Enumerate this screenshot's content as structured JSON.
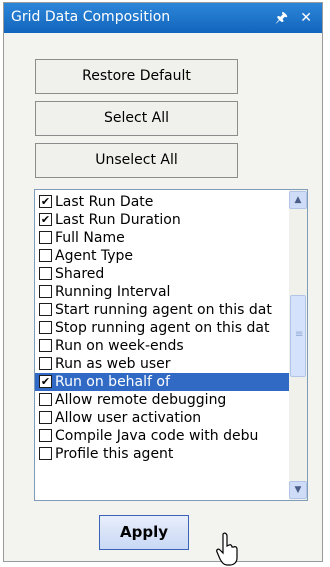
{
  "window": {
    "title": "Grid Data Composition",
    "pin_icon": "pin-icon",
    "close_icon": "close-icon"
  },
  "buttons": {
    "restore_default": "Restore Default",
    "select_all": "Select All",
    "unselect_all": "Unselect All",
    "apply": "Apply"
  },
  "list": {
    "items": [
      {
        "label": "Last Run Date",
        "checked": true,
        "selected": false
      },
      {
        "label": "Last Run Duration",
        "checked": true,
        "selected": false
      },
      {
        "label": "Full Name",
        "checked": false,
        "selected": false
      },
      {
        "label": "Agent Type",
        "checked": false,
        "selected": false
      },
      {
        "label": "Shared",
        "checked": false,
        "selected": false
      },
      {
        "label": "Running Interval",
        "checked": false,
        "selected": false
      },
      {
        "label": "Start running agent on this dat",
        "checked": false,
        "selected": false
      },
      {
        "label": "Stop running agent on this dat",
        "checked": false,
        "selected": false
      },
      {
        "label": "Run on week-ends",
        "checked": false,
        "selected": false
      },
      {
        "label": "Run as web user",
        "checked": false,
        "selected": false
      },
      {
        "label": "Run on behalf of",
        "checked": true,
        "selected": true
      },
      {
        "label": "Allow remote debugging",
        "checked": false,
        "selected": false
      },
      {
        "label": "Allow user activation",
        "checked": false,
        "selected": false
      },
      {
        "label": "Compile Java code with debu",
        "checked": false,
        "selected": false
      },
      {
        "label": "Profile this agent",
        "checked": false,
        "selected": false
      }
    ]
  },
  "colors": {
    "titlebar": "#1a6fc9",
    "selection": "#316ac5",
    "panel_bg": "#f3f3f0"
  }
}
